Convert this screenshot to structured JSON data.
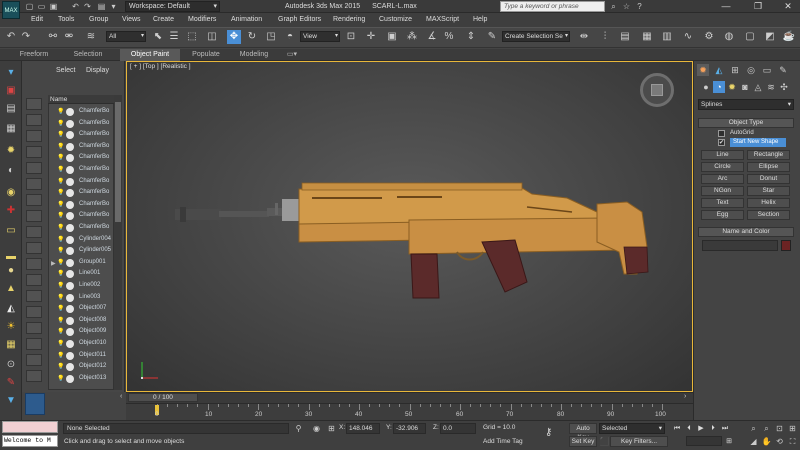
{
  "titlebar": {
    "logo": "MAX",
    "workspace_label": "Workspace: Default",
    "app_name": "Autodesk 3ds Max  2015",
    "file_name": "SCARL-L.max",
    "search_placeholder": "Type a keyword or phrase",
    "icons": [
      "binoculars-icon",
      "star-icon",
      "question-icon"
    ],
    "window_buttons": [
      "minimize",
      "restore",
      "close"
    ]
  },
  "menu": [
    "Edit",
    "Tools",
    "Group",
    "Views",
    "Create",
    "Modifiers",
    "Animation",
    "Graph Editors",
    "Rendering",
    "Customize",
    "MAXScript",
    "Help"
  ],
  "toolbar": {
    "selection_filter": "All",
    "reference_coord": "View",
    "named_selection": "Create Selection Se"
  },
  "ribbon_tabs": [
    "Freeform",
    "Selection",
    "Object Paint",
    "Populate",
    "Modeling"
  ],
  "ribbon_active": "Object Paint",
  "explorer": {
    "tabs": [
      "Select",
      "Display"
    ],
    "column_header": "Name",
    "items": [
      "ChamferBo",
      "ChamferBo",
      "ChamferBo",
      "ChamferBo",
      "ChamferBo",
      "ChamferBo",
      "ChamferBo",
      "ChamferBo",
      "ChamferBo",
      "ChamferBo",
      "ChamferBo",
      "Cylinder004",
      "Cylinder005",
      "Group001",
      "Line001",
      "Line002",
      "Line003",
      "Object007",
      "Object008",
      "Object009",
      "Object010",
      "Object011",
      "Object012",
      "Object013"
    ]
  },
  "viewport": {
    "label": "[ + ] [Top ] [Realistic ]"
  },
  "timeline": {
    "position": "0 / 100",
    "ticks": [
      "0",
      "10",
      "20",
      "30",
      "40",
      "50",
      "60",
      "70",
      "80",
      "90",
      "100"
    ]
  },
  "command_panel": {
    "category": "Splines",
    "object_type_title": "Object Type",
    "autogrid_label": "AutoGrid",
    "start_new_shape_label": "Start New Shape",
    "start_new_shape_check": "✔",
    "shapes": [
      [
        "Line",
        "Rectangle"
      ],
      [
        "Circle",
        "Ellipse"
      ],
      [
        "Arc",
        "Donut"
      ],
      [
        "NGon",
        "Star"
      ],
      [
        "Text",
        "Helix"
      ],
      [
        "Egg",
        "Section"
      ]
    ],
    "name_color_title": "Name and Color",
    "swatch_color": "#6b2323"
  },
  "statusbar": {
    "maxscript_text": "Welcome to M",
    "selection": "None Selected",
    "prompt": "Click and drag to select and move objects",
    "x_label": "X:",
    "x_value": "148.046",
    "y_label": "Y:",
    "y_value": "-32.906",
    "z_label": "Z:",
    "z_value": "0.0",
    "grid": "Grid = 10.0",
    "add_time_tag": "Add Time Tag",
    "auto_key": "Auto Key",
    "set_key": "Set Key",
    "key_mode": "Selected",
    "key_filters": "Key Filters..."
  },
  "colors": {
    "accent": "#4a8fd6",
    "viewport_border": "#e8b73a",
    "gun_tan": "#d19a4a",
    "gun_dark": "#5b2a2a"
  }
}
